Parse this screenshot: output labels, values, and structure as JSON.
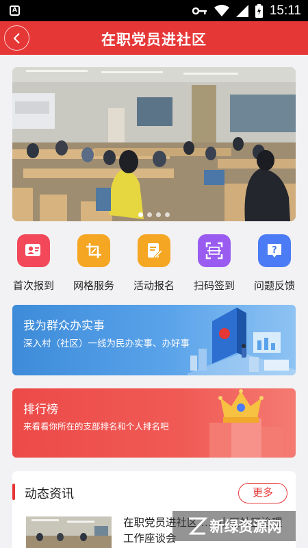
{
  "status_bar": {
    "time": "15:11",
    "app_icon_letter": "A"
  },
  "header": {
    "title": "在职党员进社区"
  },
  "banner": {
    "slides": 4,
    "active_slide": 0
  },
  "quick_actions": [
    {
      "label": "首次报到",
      "icon": "id-card-icon",
      "color": "#f2485a"
    },
    {
      "label": "网格服务",
      "icon": "grid-crop-icon",
      "color": "#f5a623"
    },
    {
      "label": "活动报名",
      "icon": "edit-document-icon",
      "color": "#f5a623"
    },
    {
      "label": "扫码签到",
      "icon": "scan-icon",
      "color": "#9a5cf0"
    },
    {
      "label": "问题反馈",
      "icon": "question-icon",
      "color": "#4b7bf5"
    }
  ],
  "service_card": {
    "title": "我为群众办实事",
    "subtitle": "深入村（社区）一线为民办实事、办好事"
  },
  "ranking_card": {
    "title": "排行榜",
    "subtitle": "来看看你所在的支部排名和个人排名吧"
  },
  "news": {
    "heading": "动态资讯",
    "more_label": "更多",
    "items": [
      {
        "title": "在职党员进社区……小区社区治理工作座谈会"
      }
    ]
  },
  "watermark": {
    "text": "新绿资源网"
  }
}
